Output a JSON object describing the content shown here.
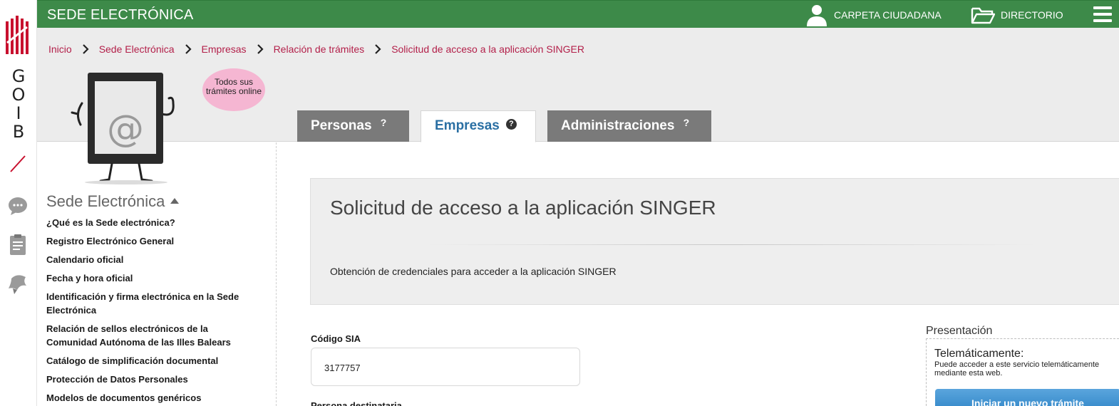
{
  "rail": {
    "letters": [
      "G",
      "O",
      "I",
      "B"
    ],
    "icons": [
      "chat-icon",
      "clipboard-icon",
      "map-icon"
    ]
  },
  "topbar": {
    "brand": "SEDE ELECTRÓNICA",
    "carpeta": "CARPETA CIUDADANA",
    "directorio": "DIRECTORIO",
    "color": "#3d8a49"
  },
  "breadcrumb": [
    "Inicio",
    "Sede Electrónica",
    "Empresas",
    "Relación de trámites",
    "Solicitud de acceso a la aplicación SINGER"
  ],
  "bubble": {
    "line1": "Todos sus",
    "line2": "trámites online"
  },
  "tabs": [
    {
      "label": "Personas",
      "q": "?"
    },
    {
      "label": "Empresas",
      "q": "?"
    },
    {
      "label": "Administraciones",
      "q": "?"
    }
  ],
  "sidebar": {
    "heading": "Sede Electrónica",
    "items": [
      "¿Qué es la Sede electrónica?",
      "Registro Electrónico General",
      "Calendario oficial",
      "Fecha y hora oficial",
      "Identificación y firma electrónica en la Sede Electrónica",
      "Relación de sellos electrónicos de la Comunidad Autónoma de las Illes Balears",
      "Catálogo de simplificación documental",
      "Protección de Datos Personales",
      "Modelos de documentos genéricos"
    ]
  },
  "main": {
    "title": "Solicitud de acceso a la aplicación SINGER",
    "description": "Obtención de credenciales para acceder a la aplicación SINGER",
    "sia_label": "Código SIA",
    "sia_value": "3177757",
    "next_label": "Persona destinataria"
  },
  "presentacion": {
    "title": "Presentación",
    "heading": "Telemáticamente:",
    "text1": "Puede acceder a este servicio telemáticamente",
    "text2": "mediante esta web.",
    "button": "Iniciar un nuevo trámite"
  }
}
